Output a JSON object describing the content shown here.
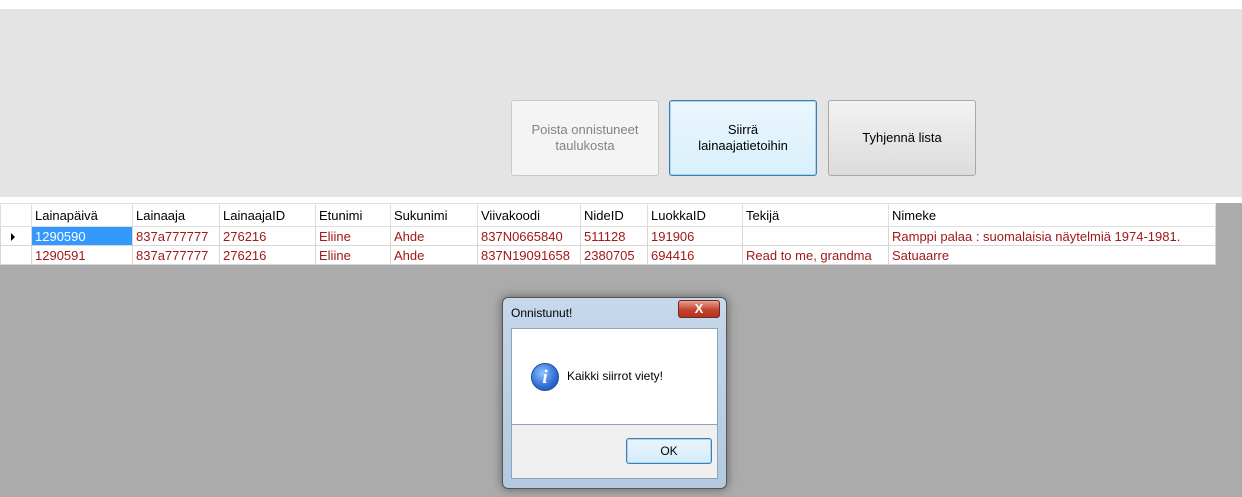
{
  "toolbar": {
    "remove_button": "Poista onnistuneet\ntaulukosta",
    "transfer_button": "Siirrä\nlainaajatietoihin",
    "clear_button": "Tyhjennä lista"
  },
  "grid": {
    "columns": [
      "Lainapäivä",
      "Lainaaja",
      "LainaajaID",
      "Etunimi",
      "Sukunimi",
      "Viivakoodi",
      "NideID",
      "LuokkaID",
      "Tekijä",
      "Nimeke"
    ],
    "rows": [
      [
        "1290590",
        "837a777777",
        "276216",
        "Eliine",
        "Ahde",
        "837N0665840",
        "511128",
        "191906",
        "",
        "Ramppi palaa : suomalaisia näytelmiä 1974-1981."
      ],
      [
        "1290591",
        "837a777777",
        "276216",
        "Eliine",
        "Ahde",
        "837N19091658",
        "2380705",
        "694416",
        "Read to me, grandma",
        "Satuaarre"
      ]
    ]
  },
  "dialog": {
    "title": "Onnistunut!",
    "close_glyph": "X",
    "icon_glyph": "i",
    "message": "Kaikki siirrot viety!",
    "ok_label": "OK"
  }
}
